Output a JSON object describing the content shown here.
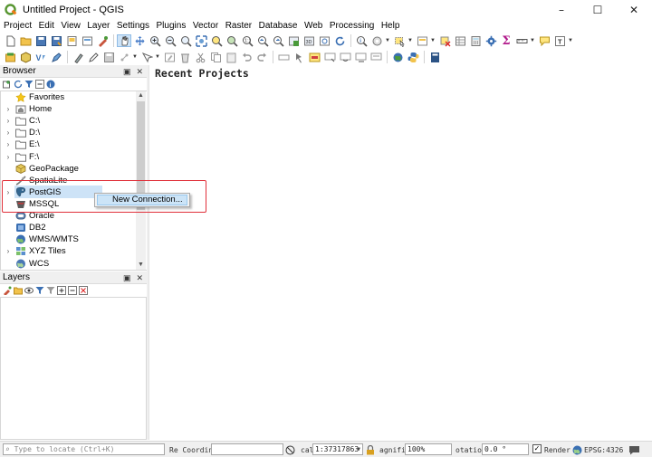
{
  "window": {
    "title": "Untitled Project - QGIS",
    "controls": [
      "–",
      "☐",
      "✕"
    ]
  },
  "menu": [
    "Project",
    "Edit",
    "View",
    "Layer",
    "Settings",
    "Plugins",
    "Vector",
    "Raster",
    "Database",
    "Web",
    "Processing",
    "Help"
  ],
  "browser_panel": {
    "title": "Browser",
    "float_btn": "▣",
    "close_btn": "✕",
    "items": [
      {
        "label": "Favorites",
        "icon": "star-icon",
        "expand": ""
      },
      {
        "label": "Home",
        "icon": "home-folder-icon",
        "expand": "›"
      },
      {
        "label": "C:\\",
        "icon": "folder-icon",
        "expand": "›"
      },
      {
        "label": "D:\\",
        "icon": "folder-icon",
        "expand": "›"
      },
      {
        "label": "E:\\",
        "icon": "folder-icon",
        "expand": "›"
      },
      {
        "label": "F:\\",
        "icon": "folder-icon",
        "expand": "›"
      },
      {
        "label": "GeoPackage",
        "icon": "geopackage-icon",
        "expand": ""
      },
      {
        "label": "SpatiaLite",
        "icon": "spatialite-icon",
        "expand": ""
      },
      {
        "label": "PostGIS",
        "icon": "postgis-icon",
        "expand": "›"
      },
      {
        "label": "MSSQL",
        "icon": "mssql-icon",
        "expand": ""
      },
      {
        "label": "Oracle",
        "icon": "oracle-icon",
        "expand": ""
      },
      {
        "label": "DB2",
        "icon": "db2-icon",
        "expand": ""
      },
      {
        "label": "WMS/WMTS",
        "icon": "wms-icon",
        "expand": ""
      },
      {
        "label": "XYZ Tiles",
        "icon": "xyz-tiles-icon",
        "expand": "›"
      },
      {
        "label": "WCS",
        "icon": "wcs-icon",
        "expand": ""
      }
    ]
  },
  "context_menu": {
    "items": [
      "New Connection..."
    ]
  },
  "layers_panel": {
    "title": "Layers",
    "float_btn": "▣",
    "close_btn": "✕"
  },
  "main": {
    "recent_title": "Recent Projects"
  },
  "status_bar": {
    "locate_placeholder": "Type to locate (Ctrl+K)",
    "coordinate_label": "Re Coordinate",
    "coordinate_value": "",
    "scale_label": "cal",
    "scale_value": "1:37317863",
    "magnifier_label": "agnifie",
    "magnifier_value": "100%",
    "rotation_label": "otatio",
    "rotation_value": "0.0 °",
    "render_label": "Render",
    "crs_label": "EPSG:4326"
  },
  "colors": {
    "accent_selection": "#cde3f7",
    "highlight_box": "#e0303a",
    "qgis_green": "#589632"
  }
}
